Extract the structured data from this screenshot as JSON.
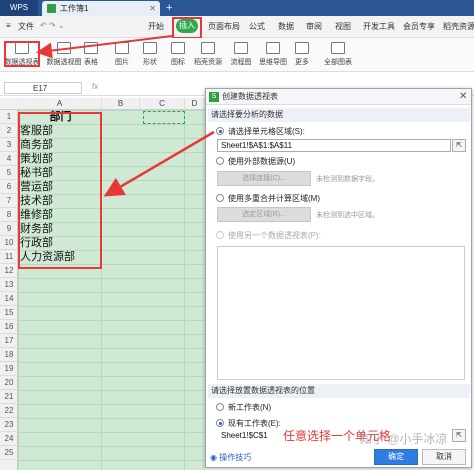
{
  "titlebar": {
    "app": "WPS",
    "doc": "工作簿1",
    "new_tab": "+"
  },
  "menubar": {
    "items": [
      "文件",
      "开始",
      "插入",
      "页面布局",
      "公式",
      "数据",
      "审阅",
      "视图",
      "开发工具",
      "会员专享",
      "稻壳资源"
    ],
    "active": "插入"
  },
  "toolbar": {
    "items": [
      "数据透视表",
      "数据透视图",
      "表格",
      "图片",
      "形状",
      "图标",
      "稻壳资源",
      "流程图",
      "思维导图",
      "更多",
      "全部图表"
    ]
  },
  "formula_bar": {
    "namebox": "E17",
    "fx": "fx"
  },
  "sheet": {
    "columns": [
      "A",
      "B",
      "C",
      "D"
    ],
    "rows": [
      "1",
      "2",
      "3",
      "4",
      "5",
      "6",
      "7",
      "8",
      "9",
      "10",
      "11",
      "12",
      "13",
      "14",
      "15",
      "16",
      "17",
      "18",
      "19",
      "20",
      "21",
      "22",
      "23",
      "24",
      "25"
    ],
    "a_values": [
      "部门",
      "客服部",
      "商务部",
      "策划部",
      "秘书部",
      "营运部",
      "技术部",
      "维修部",
      "财务部",
      "行政部",
      "人力资源部"
    ]
  },
  "dialog": {
    "title": "创建数据透视表",
    "section1": "请选择要分析的数据",
    "opt_region": "请选择单元格区域(S):",
    "region_value": "Sheet1!$A$1:$A$11",
    "opt_external": "使用外部数据源(U)",
    "select_conn": "选择连接(C)...",
    "hint_fields": "未检测到数据字段。",
    "opt_multi": "使用多重合并计算区域(M)",
    "select_region": "选定区域(R)...",
    "hint_region": "未检测到选中区域。",
    "opt_pivot": "使用另一个数据透视表(P):",
    "section2": "请选择放置数据透视表的位置",
    "opt_new": "新工作表(N)",
    "opt_existing": "现有工作表(E):",
    "existing_value": "Sheet1!$C$1",
    "tips": "操作技巧",
    "ok": "确定",
    "cancel": "取消"
  },
  "annotation": "任意选择一个单元格",
  "watermark": "知乎 @小手冰凉",
  "colors": {
    "accent": "#2fa84f",
    "highlight": "#e53935",
    "title_bar": "#2b5797",
    "sheet_fill": "#cfe9d4"
  }
}
